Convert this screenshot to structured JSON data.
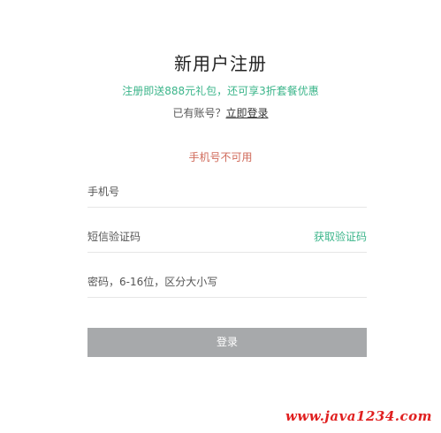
{
  "register": {
    "title": "新用户注册",
    "promo": "注册即送888元礼包，还可享3折套餐优惠",
    "has_account_text": "已有账号？",
    "login_link": "立即登录",
    "error_message": "手机号不可用"
  },
  "form": {
    "phone_placeholder": "手机号",
    "code_placeholder": "短信验证码",
    "get_code_label": "获取验证码",
    "password_placeholder": "密码，6-16位，区分大小写",
    "submit_label": "登录"
  },
  "watermark": "www.java1234.com",
  "colors": {
    "accent_green": "#3bb58a",
    "error_red": "#d06a5a",
    "button_gray": "#a7a9ab",
    "watermark_red": "#e02020"
  }
}
